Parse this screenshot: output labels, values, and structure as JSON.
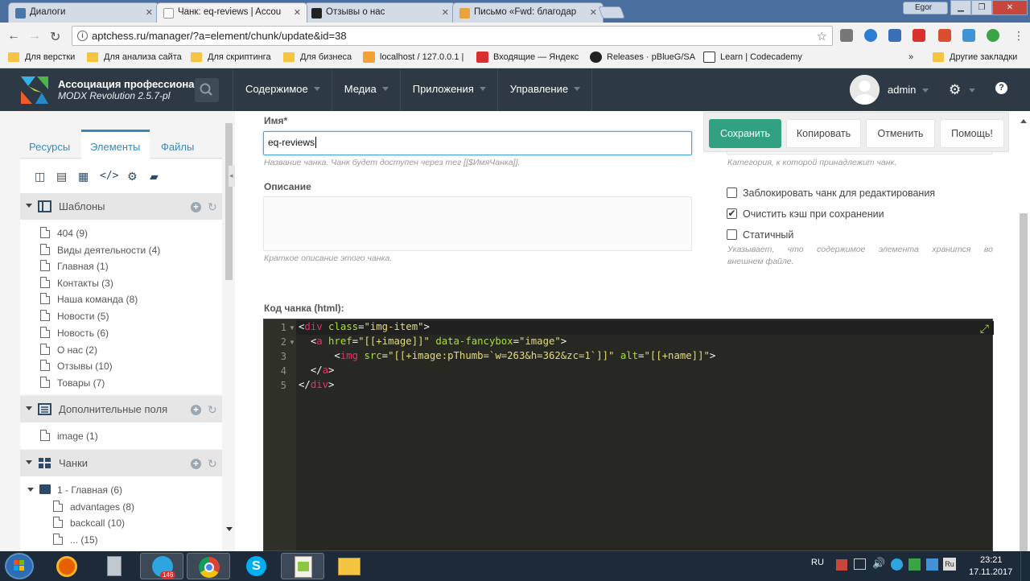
{
  "browser": {
    "tabs": [
      {
        "title": "Диалоги",
        "color": "#4a76a8"
      },
      {
        "title": "Чанк: eq-reviews | Accou",
        "color": "#eeeeee"
      },
      {
        "title": "Отзывы о нас",
        "color": "#222222"
      },
      {
        "title": "Письмо «Fwd: благодар",
        "color": "#e8a33d"
      }
    ],
    "user_badge": "Egor",
    "url": "aptchess.ru/manager/?a=element/chunk/update&id=38",
    "bookmarks": [
      "Для верстки",
      "Для анализа сайта",
      "Для скриптинга",
      "Для бизнеса",
      "localhost / 127.0.0.1 |",
      "Входящие — Яндекс",
      "Releases · pBlueG/SA",
      "Learn | Codecademy"
    ],
    "bookmarks_overflow": "»",
    "other_bookmarks": "Другие закладки"
  },
  "header": {
    "site_name": "Ассоциация профессиона...",
    "version": "MODX Revolution 2.5.7-pl",
    "menu": [
      "Содержимое",
      "Медиа",
      "Приложения",
      "Управление"
    ],
    "username": "admin",
    "help": "?"
  },
  "sidebar": {
    "tabs": [
      "Ресурсы",
      "Элементы",
      "Файлы"
    ],
    "sections": [
      {
        "title": "Шаблоны",
        "items": [
          "404 (9)",
          "Виды деятельности (4)",
          "Главная (1)",
          "Контакты (3)",
          "Наша команда (8)",
          "Новости (5)",
          "Новость (6)",
          "О нас (2)",
          "Отзывы (10)",
          "Товары (7)"
        ]
      },
      {
        "title": "Дополнительные поля",
        "items": [
          "image (1)"
        ]
      },
      {
        "title": "Чанки",
        "category": "1 - Главная (6)",
        "items": [
          "advantages (8)",
          "backcall (10)",
          "...  (15)"
        ]
      }
    ]
  },
  "form": {
    "name_label": "Имя*",
    "name_value": "eq-reviews",
    "name_hint": "Название чанка. Чанк будет доступен через тег [[$ИмяЧанка]].",
    "desc_label": "Описание",
    "desc_value": "",
    "desc_hint": "Краткое описание этого чанка.",
    "category_hint": "Категория, к которой принадлежит чанк.",
    "checkboxes": [
      {
        "label": "Заблокировать чанк для редактирования",
        "checked": false
      },
      {
        "label": "Очистить кэш при сохранении",
        "checked": true
      },
      {
        "label": "Статичный",
        "checked": false
      }
    ],
    "static_hint_1": "Указывает, что содержимое элемента хранится во",
    "static_hint_2": "внешнем файле.",
    "code_label": "Код чанка (html):"
  },
  "buttons": {
    "save": "Сохранить",
    "copy": "Копировать",
    "cancel": "Отменить",
    "help": "Помощь!"
  },
  "code": {
    "line_numbers": [
      "1",
      "2",
      "3",
      "4",
      "5"
    ],
    "lines": [
      "<div class=\"img-item\">",
      "  <a href=\"[[+image]]\" data-fancybox=\"image\">",
      "      <img src=\"[[+image:pThumb=`w=263&h=362&zc=1`]]\" alt=\"[[+name]]\">",
      "  </a>",
      "</div>"
    ]
  },
  "taskbar": {
    "badge": "146",
    "lang": "RU",
    "time": "23:21",
    "date": "17.11.2017"
  }
}
